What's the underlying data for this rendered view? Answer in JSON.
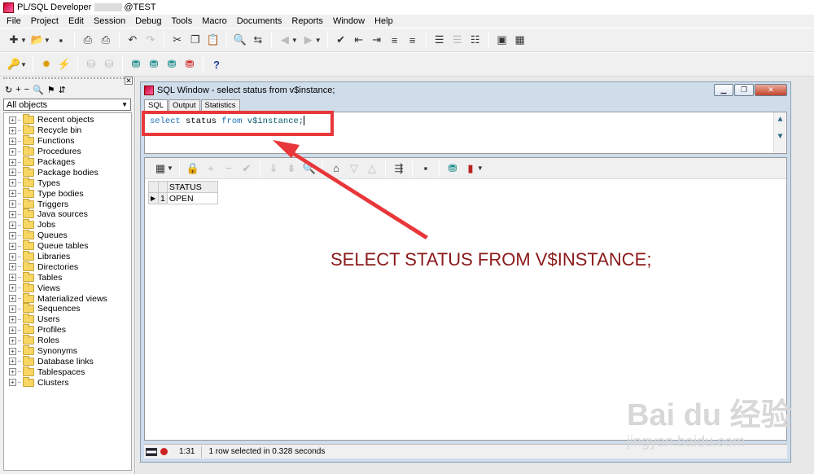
{
  "app": {
    "title_left": "PL/SQL Developer",
    "title_right": "@TEST"
  },
  "menu": [
    "File",
    "Project",
    "Edit",
    "Session",
    "Debug",
    "Tools",
    "Macro",
    "Documents",
    "Reports",
    "Window",
    "Help"
  ],
  "browser": {
    "filter": "All objects",
    "items": [
      "Recent objects",
      "Recycle bin",
      "Functions",
      "Procedures",
      "Packages",
      "Package bodies",
      "Types",
      "Type bodies",
      "Triggers",
      "Java sources",
      "Jobs",
      "Queues",
      "Queue tables",
      "Libraries",
      "Directories",
      "Tables",
      "Views",
      "Materialized views",
      "Sequences",
      "Users",
      "Profiles",
      "Roles",
      "Synonyms",
      "Database links",
      "Tablespaces",
      "Clusters"
    ]
  },
  "sql_window": {
    "title": "SQL Window - select status from v$instance;",
    "tabs": [
      "SQL",
      "Output",
      "Statistics"
    ],
    "query": {
      "kw1": "select",
      "col": "status",
      "kw2": "from",
      "table": "v$instance;"
    },
    "grid": {
      "column": "STATUS",
      "rows": [
        {
          "num": "1",
          "value": "OPEN"
        }
      ]
    },
    "status": {
      "position": "1:31",
      "message": "1 row selected in 0.328 seconds"
    }
  },
  "annotation": "SELECT STATUS FROM V$INSTANCE;",
  "watermark": {
    "main": "Bai du 经验",
    "sub": "jingyan.baidu.com"
  },
  "colors": {
    "highlight": "#e8373a",
    "annotation": "#8b1a1a",
    "keyword": "#1c6fb5"
  }
}
